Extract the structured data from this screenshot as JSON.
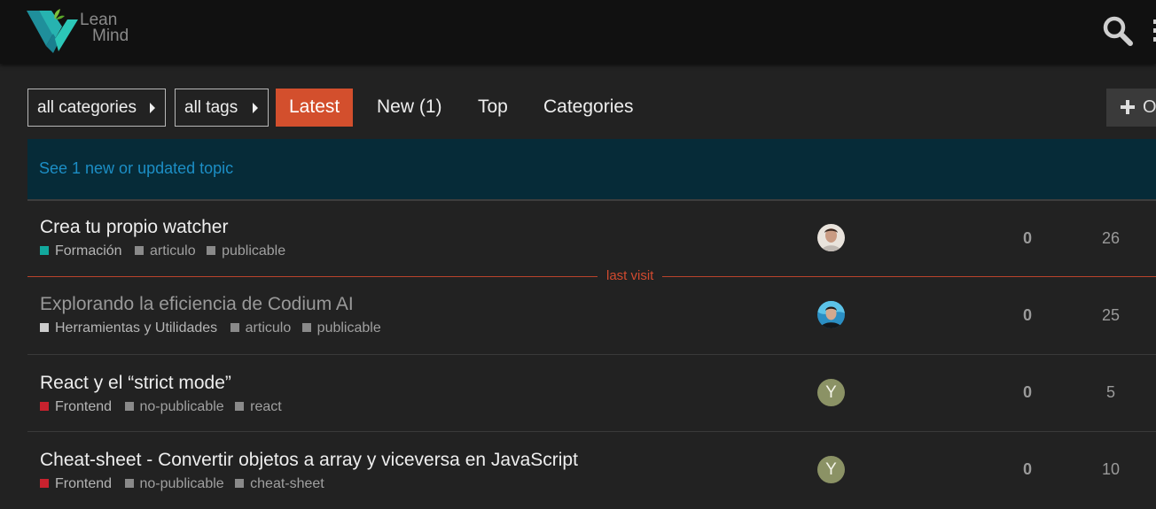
{
  "brand": {
    "logo_line1": "Lean",
    "logo_line2": "Mind"
  },
  "header": {
    "search_icon": "search-icon",
    "menu_icon": "vertical-dots-icon"
  },
  "navigation": {
    "categories_dropdown": "all categories",
    "tags_dropdown": "all tags",
    "tabs": [
      {
        "label": "Latest",
        "active": true
      },
      {
        "label": "New (1)",
        "active": false
      },
      {
        "label": "Top",
        "active": false
      },
      {
        "label": "Categories",
        "active": false
      }
    ],
    "new_topic_label": "O"
  },
  "banner": {
    "text": "See 1 new or updated topic"
  },
  "last_visit_label": "last visit",
  "topics": [
    {
      "title": "Crea tu propio watcher",
      "visited": false,
      "category": "Formación",
      "category_color": "#12a89d",
      "tags": [
        "articulo",
        "publicable"
      ],
      "avatar": "photo-1",
      "replies": "0",
      "views": "26"
    },
    {
      "title": "Explorando la eficiencia de Codium AI",
      "visited": true,
      "category": "Herramientas y Utilidades",
      "category_color": "#cccccc",
      "tags": [
        "articulo",
        "publicable"
      ],
      "avatar": "photo-2",
      "replies": "0",
      "views": "25"
    },
    {
      "title": "React y el “strict mode”",
      "visited": false,
      "category": "Frontend",
      "category_color": "#c8222e",
      "tags": [
        "no-publicable",
        "react"
      ],
      "avatar_letter": "Y",
      "replies": "0",
      "views": "5"
    },
    {
      "title": "Cheat-sheet - Convertir objetos a array y viceversa en JavaScript",
      "visited": false,
      "category": "Frontend",
      "category_color": "#c8222e",
      "tags": [
        "no-publicable",
        "cheat-sheet"
      ],
      "avatar_letter": "Y",
      "replies": "0",
      "views": "10"
    }
  ],
  "colors": {
    "accent": "#d34f2d",
    "banner_bg": "#062b38",
    "banner_link": "#1c8ec5"
  }
}
